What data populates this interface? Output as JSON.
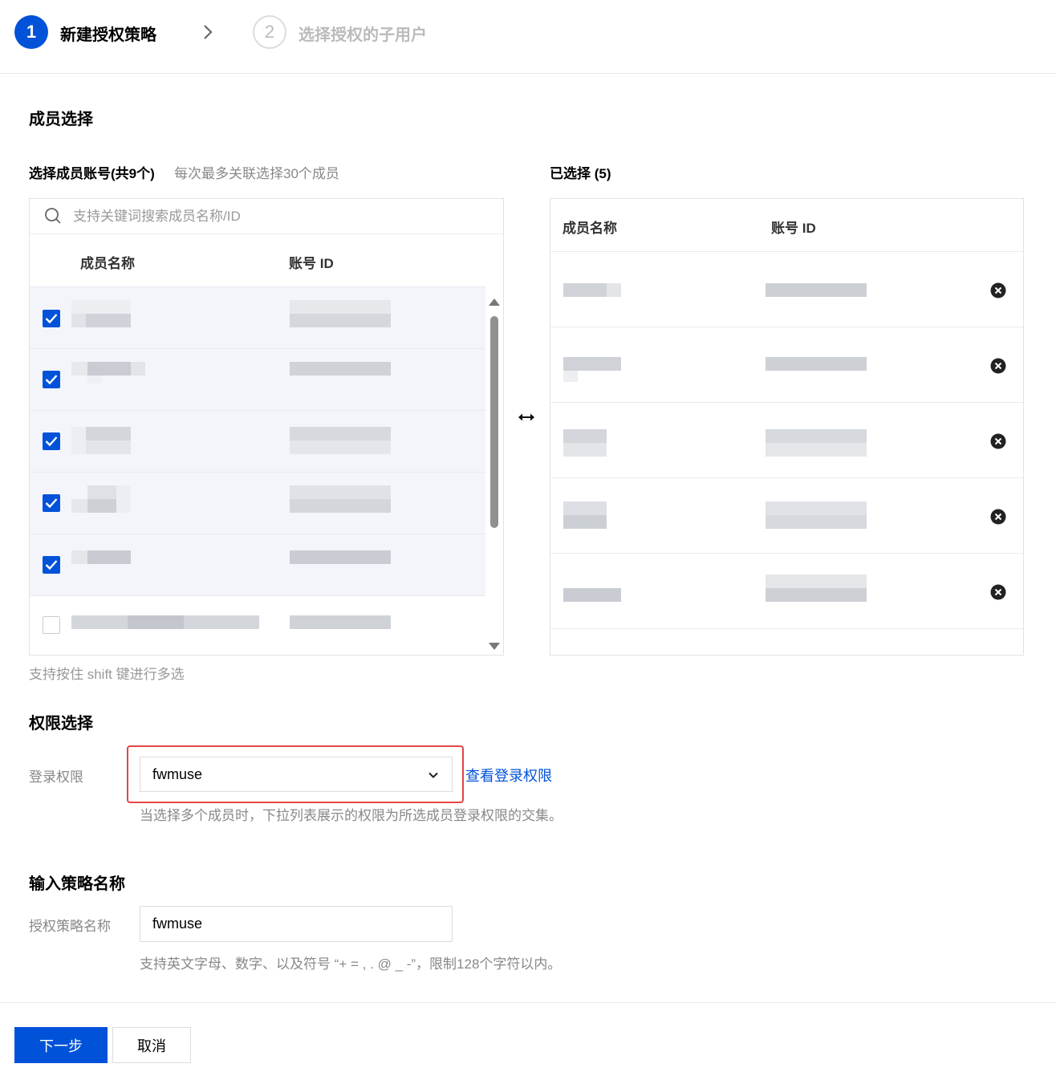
{
  "steps": [
    {
      "number": "1",
      "label": "新建授权策略",
      "active": true
    },
    {
      "number": "2",
      "label": "选择授权的子用户",
      "active": false
    }
  ],
  "members_section": {
    "title": "成员选择",
    "left_title": "选择成员账号(共9个)",
    "left_hint": "每次最多关联选择30个成员",
    "right_title": "已选择 (5)",
    "search_placeholder": "支持关键词搜索成员名称/ID",
    "columns": {
      "name": "成员名称",
      "id": "账号 ID"
    },
    "left_rows_checked": [
      true,
      true,
      true,
      true,
      true,
      false
    ],
    "right_row_count": 5,
    "multi_select_hint": "支持按住 shift 键进行多选",
    "icons": {
      "search": "search-icon",
      "swap": "swap-icon",
      "remove": "close-circle-icon",
      "check": "check-icon"
    }
  },
  "permission_section": {
    "title": "权限选择",
    "label": "登录权限",
    "selected_value": "fwmuse",
    "view_link": "查看登录权限",
    "hint": "当选择多个成员时，下拉列表展示的权限为所选成员登录权限的交集。"
  },
  "policy_section": {
    "title": "输入策略名称",
    "label": "授权策略名称",
    "value": "fwmuse",
    "hint": "支持英文字母、数字、以及符号 “+ = , . @ _ -”，限制128个字符以内。"
  },
  "footer": {
    "next": "下一步",
    "cancel": "取消"
  },
  "colors": {
    "primary": "#0052d9",
    "highlight": "#e54545",
    "muted": "#888888"
  }
}
